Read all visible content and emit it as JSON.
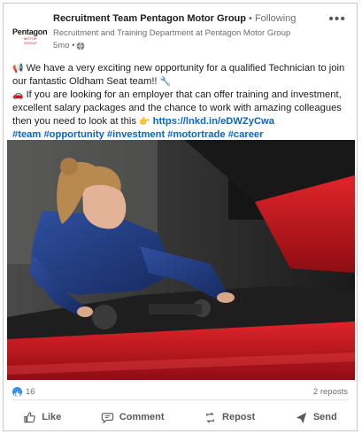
{
  "post": {
    "author": "Recruitment Team Pentagon Motor Group",
    "following": " • Following",
    "subtitle": "Recruitment and Training Department at Pentagon Motor Group",
    "time": "5mo •",
    "logo_text": "Pentagon",
    "logo_sub": "MOTOR GROUP",
    "more": "•••",
    "body_line1": "We have a very exciting new opportunity for a qualified Technician to join our fantastic Oldham Seat team!!",
    "body_line2": "If you are looking for an employer that can offer training and investment, excellent salary packages and the chance to work with amazing colleagues then you need to look at this",
    "link": "https://lnkd.in/eDWZyCwa",
    "hashtags": "#team #opportunity #investment #motortrade #career"
  },
  "stats": {
    "likes": "16",
    "reposts": "2 reposts"
  },
  "actions": {
    "like": "Like",
    "comment": "Comment",
    "repost": "Repost",
    "send": "Send"
  },
  "colors": {
    "link": "#0a66c2",
    "like_badge": "#378fe9",
    "car_red": "#c4141b"
  }
}
